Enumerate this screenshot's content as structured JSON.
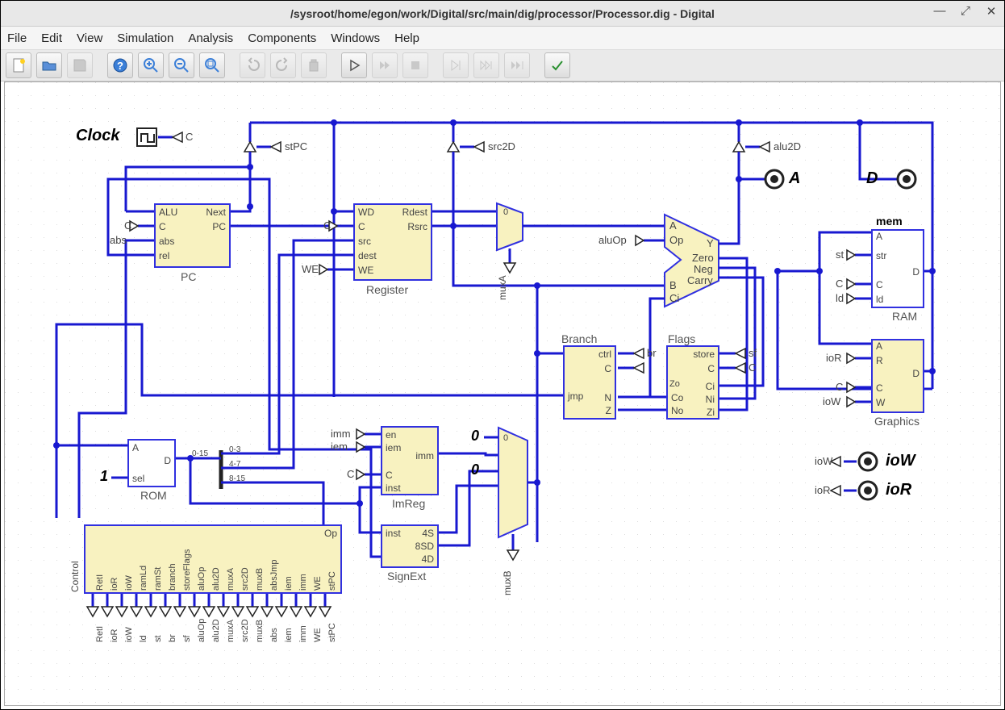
{
  "window": {
    "title": "/sysroot/home/egon/work/Digital/src/main/dig/processor/Processor.dig - Digital"
  },
  "menu": {
    "file": "File",
    "edit": "Edit",
    "view": "View",
    "simulation": "Simulation",
    "analysis": "Analysis",
    "components": "Components",
    "windows": "Windows",
    "help": "Help"
  },
  "clock_label": "Clock",
  "clock_sig": "C",
  "signals": {
    "stPC": "stPC",
    "src2D": "src2D",
    "alu2D": "alu2D",
    "aluOp": "aluOp",
    "imm": "imm",
    "iem": "iem",
    "WE": "WE",
    "C": "C",
    "br": "br",
    "sf": "sf",
    "ioR": "ioR",
    "ioW": "ioW",
    "st": "st",
    "ld": "ld",
    "muxA": "muxA",
    "muxB": "muxB",
    "abs": "abs",
    "rel": "rel"
  },
  "comp": {
    "pc": {
      "name": "PC",
      "pins": {
        "alu": "ALU",
        "c": "C",
        "abs": "abs",
        "rel": "rel",
        "next": "Next",
        "pc": "PC"
      }
    },
    "reg": {
      "name": "Register",
      "pins": {
        "wd": "WD",
        "c": "C",
        "src": "src",
        "dest": "dest",
        "we": "WE",
        "rdest": "Rdest",
        "rsrc": "Rsrc"
      }
    },
    "alu": {
      "pins": {
        "a": "A",
        "op": "Op",
        "b": "B",
        "ci": "Ci",
        "y": "Y",
        "zero": "Zero",
        "neg": "Neg",
        "carry": "Carry"
      }
    },
    "branch": {
      "name": "Branch",
      "pins": {
        "ctrl": "ctrl",
        "c": "C",
        "jmp": "jmp",
        "n": "N",
        "z": "Z"
      }
    },
    "flags": {
      "name": "Flags",
      "pins": {
        "store": "store",
        "c": "C",
        "co": "Co",
        "no": "No",
        "zo": "Zo",
        "ci": "Ci",
        "ni": "Ni",
        "zi": "Zi"
      }
    },
    "ram": {
      "name": "RAM",
      "mem": "mem",
      "pins": {
        "a": "A",
        "str": "str",
        "d": "D",
        "c": "C",
        "ld": "ld"
      }
    },
    "gfx": {
      "name": "Graphics",
      "pins": {
        "a": "A",
        "r": "R",
        "d": "D",
        "c": "C",
        "w": "W"
      }
    },
    "imreg": {
      "name": "ImReg",
      "pins": {
        "en": "en",
        "iem": "iem",
        "c": "C",
        "inst": "inst",
        "imm": "imm"
      }
    },
    "signext": {
      "name": "SignExt",
      "pins": {
        "inst": "inst",
        "s4": "4S",
        "sd8": "8SD",
        "d4": "4D"
      }
    },
    "rom": {
      "name": "ROM",
      "pins": {
        "a": "A",
        "sel": "sel",
        "d": "D"
      }
    },
    "control": {
      "name": "Control",
      "cols": [
        "RetI",
        "ioR",
        "ioW",
        "ramLd",
        "ramSt",
        "branch",
        "storeFlags",
        "aluOp",
        "alu2D",
        "muxA",
        "src2D",
        "muxB",
        "absJmp",
        "iem",
        "imm",
        "WE",
        "stPC"
      ],
      "cols2": [
        "RetI",
        "ioR",
        "ioW",
        "ld",
        "st",
        "br",
        "sf",
        "aluOp",
        "alu2D",
        "muxA",
        "src2D",
        "muxB",
        "abs",
        "iem",
        "imm",
        "WE",
        "stPC"
      ],
      "op": "Op"
    },
    "splitter": {
      "r1": "0-15",
      "r2": "0-3",
      "r3": "4-7",
      "r4": "8-15"
    }
  },
  "const": {
    "one": "1",
    "zero": "0"
  },
  "probes": {
    "A": "A",
    "D": "D",
    "ioW": "ioW",
    "ioR": "ioR"
  }
}
